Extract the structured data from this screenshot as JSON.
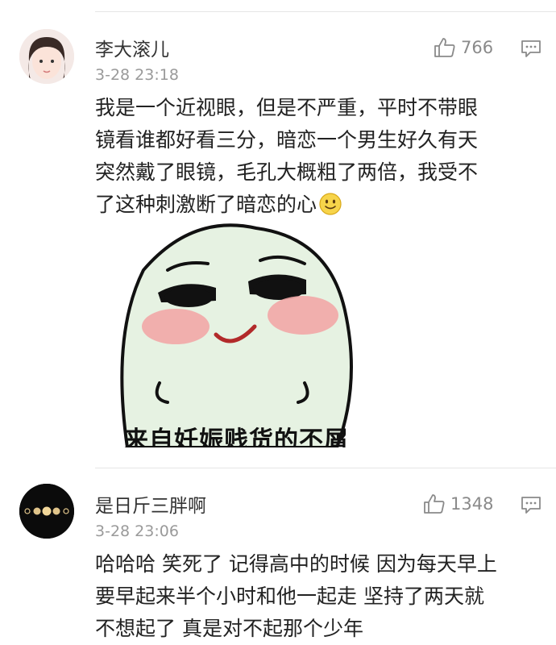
{
  "comments": [
    {
      "username": "李大滚儿",
      "time": "3-28 23:18",
      "likes": "766",
      "text_lines": [
        "我是一个近视眼，但是不严重，平时不带眼",
        "镜看谁都好看三分，暗恋一个男生好久有天",
        "突然戴了眼镜，毛孔大概粗了两倍，我受不",
        "了这种刺激断了暗恋的心"
      ],
      "sticker": {
        "caption": "来自妊娠贱货的不屑"
      }
    },
    {
      "username": "是日斤三胖啊",
      "time": "3-28 23:06",
      "likes": "1348",
      "text_lines": [
        "哈哈哈 笑死了 记得高中的时候 因为每天早上",
        "要早起来半个小时和他一起走 坚持了两天就",
        "不想起了 真是对不起那个少年"
      ]
    }
  ],
  "icons": {
    "like": "thumbs-up-icon",
    "reply": "comment-bubble-icon",
    "emoji": "smiley-face-icon"
  },
  "colors": {
    "meta": "#9a9a9a",
    "text": "#222222",
    "divider": "#e5e5e5"
  }
}
